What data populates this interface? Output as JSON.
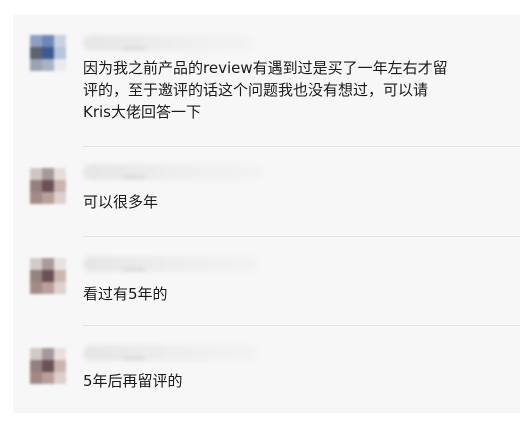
{
  "comments": [
    {
      "author": "",
      "text": "因为我之前产品的review有遇到过是买了一年左右才留\n评的，至于邀评的话这个问题我也没有想过，可以请\nKris大佬回答一下",
      "avatar_colors": [
        "#8d9fc4",
        "#6f86b6",
        "#c9d2e2",
        "#5c6270",
        "#3d5a93",
        "#b7c4dc",
        "#9aa3b1",
        "#a9b3c4",
        "#e7eaf0"
      ]
    },
    {
      "author": "",
      "text": "可以很多年",
      "avatar_colors": [
        "#cfc7c4",
        "#a7999a",
        "#e6dedc",
        "#94807f",
        "#6c5257",
        "#cbb3b1",
        "#a38a86",
        "#b89f9b",
        "#ddcfcb"
      ]
    },
    {
      "author": "",
      "text": "看过有5年的",
      "avatar_colors": [
        "#d3cbc8",
        "#a99b9b",
        "#e9e2df",
        "#96827f",
        "#6a5156",
        "#cdb5b2",
        "#a48b87",
        "#ba9f9c",
        "#dfd1cd"
      ]
    },
    {
      "author": "",
      "text": "5年后再留评的",
      "avatar_colors": [
        "#d1c9c6",
        "#a6989a",
        "#e8e0de",
        "#94807e",
        "#6b5257",
        "#ccb4b1",
        "#a28985",
        "#b99e9a",
        "#ddd0cc"
      ]
    }
  ],
  "colors": {
    "background": "#f7f7f7",
    "text": "#1a1a1a",
    "divider": "#e4e4e4"
  }
}
